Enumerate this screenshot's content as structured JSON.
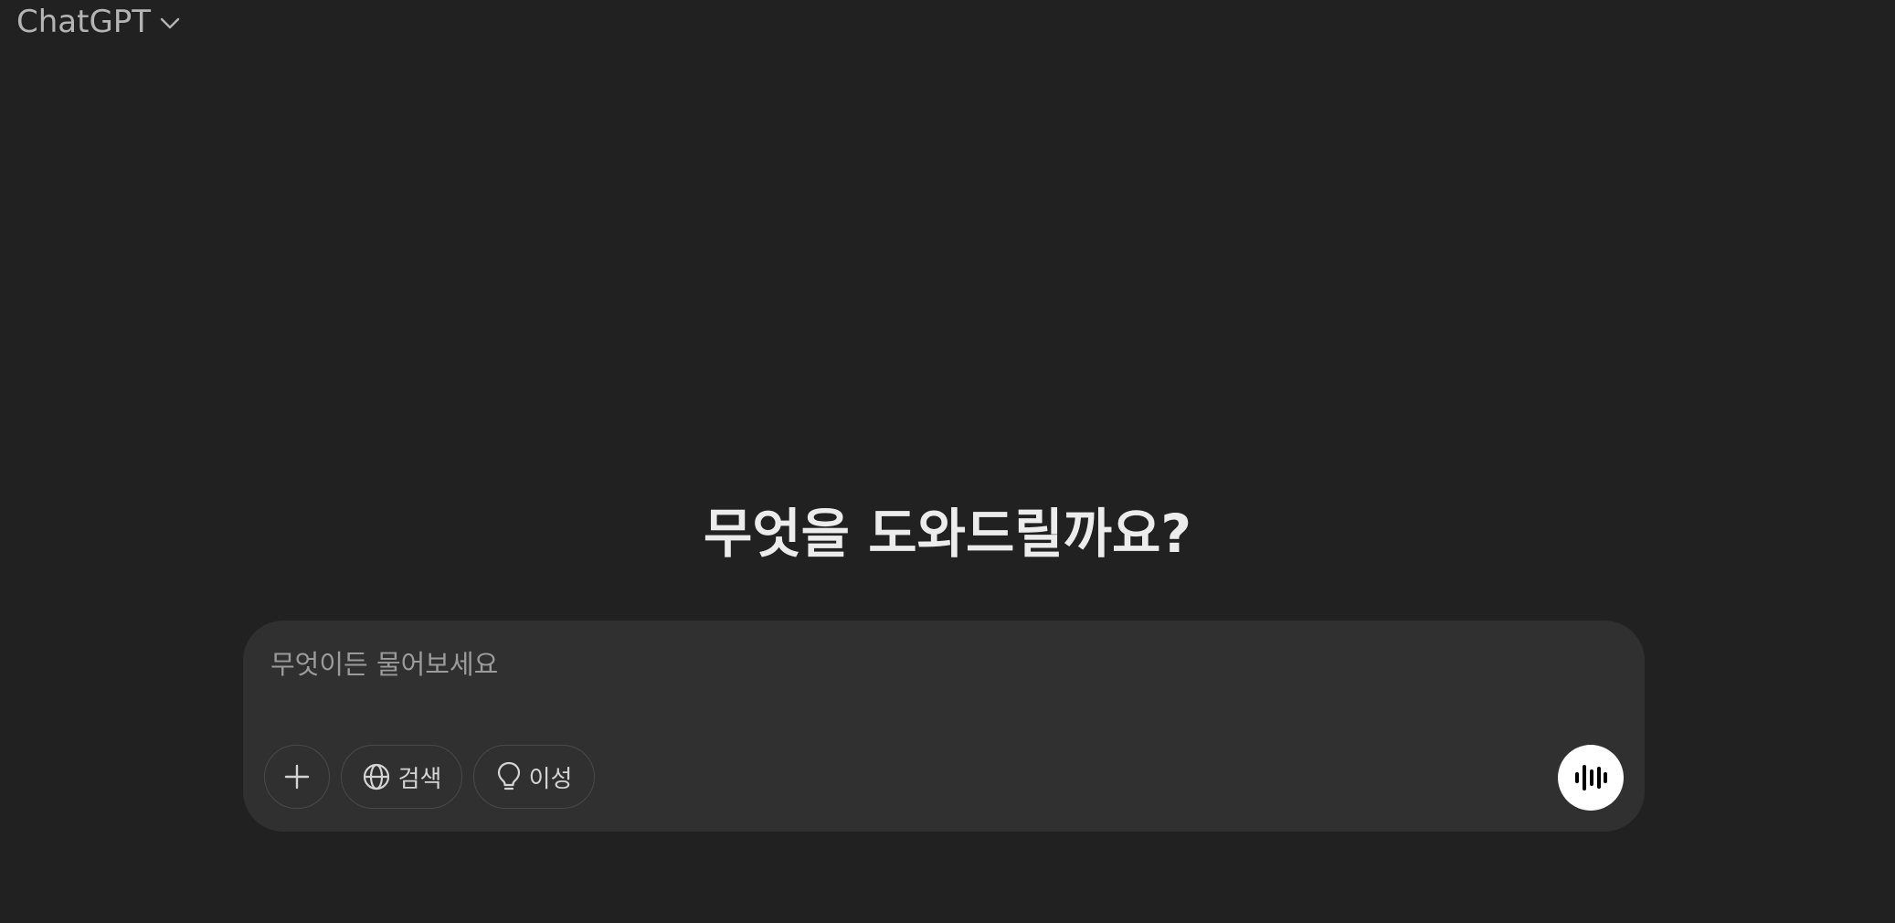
{
  "header": {
    "model_name": "ChatGPT",
    "model_dropdown_icon": "chevron-down-icon"
  },
  "main": {
    "headline": "무엇을 도와드릴까요?"
  },
  "composer": {
    "placeholder": "무엇이든 물어보세요",
    "value": "",
    "buttons": {
      "add_icon": "plus-icon",
      "search_label": "검색",
      "search_icon": "globe-icon",
      "reason_label": "이성",
      "reason_icon": "lightbulb-icon",
      "voice_icon": "voice-waveform-icon"
    }
  },
  "colors": {
    "background": "#212121",
    "composer_bg": "#303030",
    "text_primary": "#ececec",
    "text_muted": "#b4b4b4",
    "placeholder": "#9b9b9b",
    "voice_button_bg": "#ffffff"
  }
}
